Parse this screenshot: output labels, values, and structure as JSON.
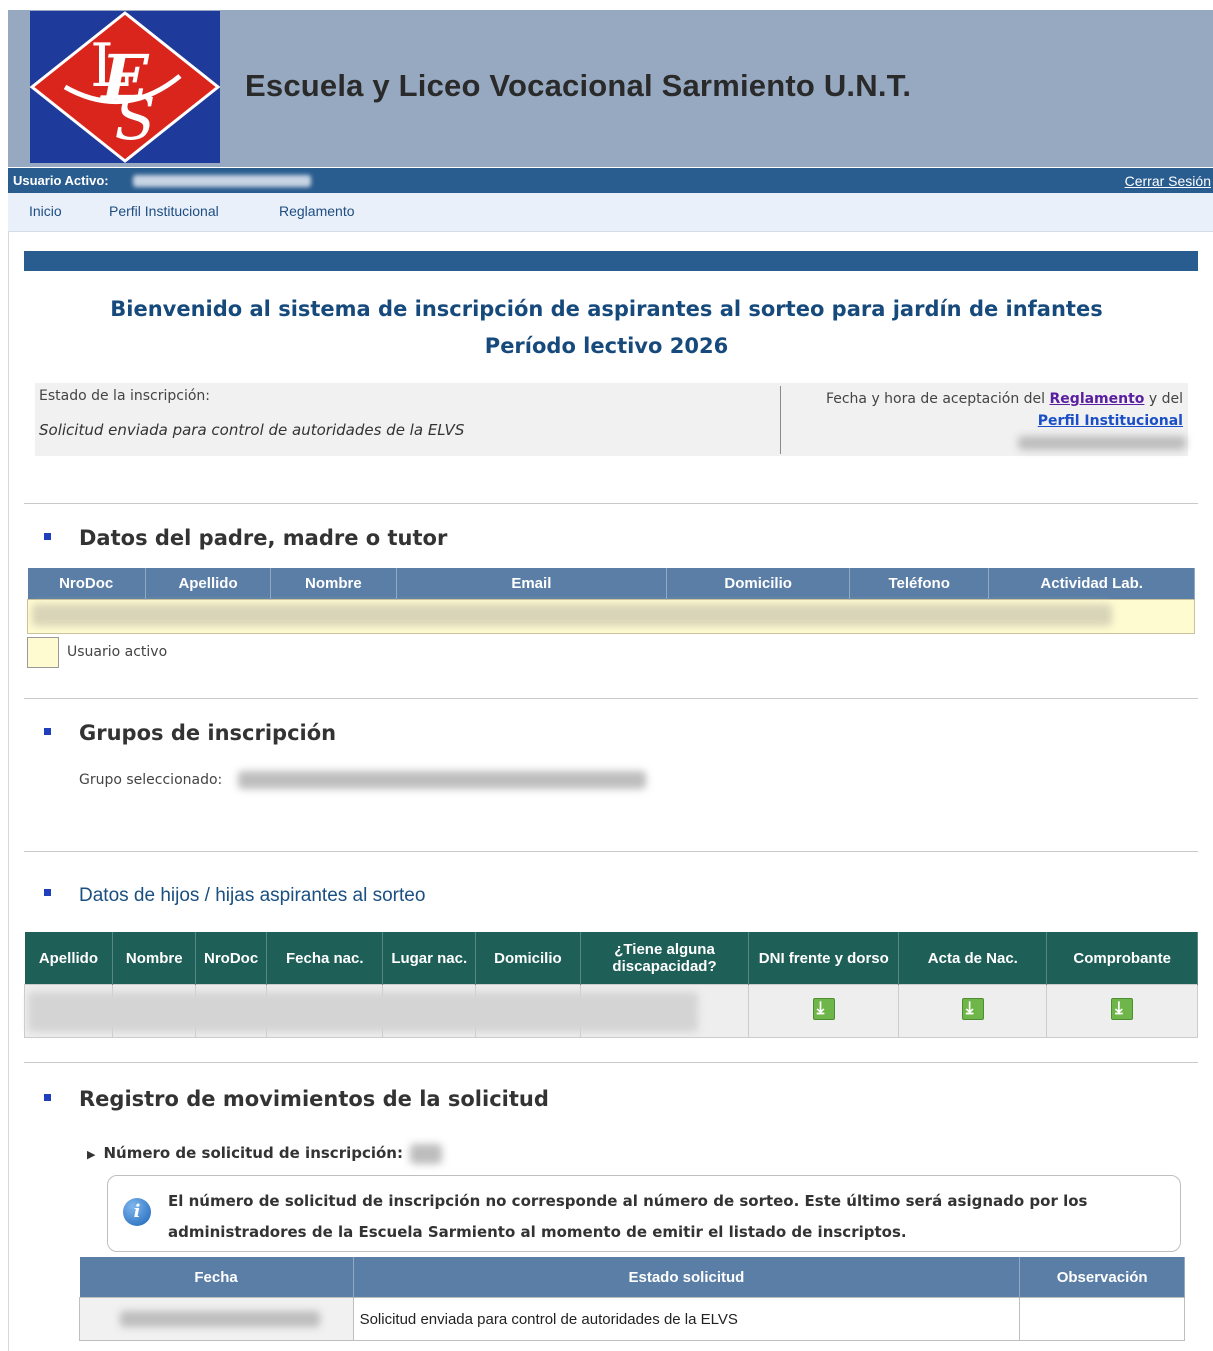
{
  "header": {
    "title": "Escuela y Liceo Vocacional Sarmiento U.N.T."
  },
  "userbar": {
    "label": "Usuario Activo:",
    "logout": "Cerrar Sesión"
  },
  "nav": {
    "items": [
      "Inicio",
      "Perfil Institucional",
      "Reglamento"
    ]
  },
  "welcome": {
    "line1": "Bienvenido al sistema de inscripción de aspirantes al sorteo para jardín de infantes",
    "line2": "Período lectivo 2026"
  },
  "status": {
    "label": "Estado de la inscripción:",
    "value": "Solicitud enviada para control de autoridades de la ELVS",
    "acceptance_prefix": "Fecha y hora de aceptación del",
    "reglamento_link": "Reglamento",
    "connector": "y del",
    "perfil_link": "Perfil Institucional"
  },
  "parents": {
    "title": "Datos del padre, madre o tutor",
    "columns": [
      "NroDoc",
      "Apellido",
      "Nombre",
      "Email",
      "Domicilio",
      "Teléfono",
      "Actividad Lab."
    ],
    "legend": "Usuario activo"
  },
  "groups": {
    "title": "Grupos de inscripción",
    "selected_label": "Grupo seleccionado:"
  },
  "children": {
    "title": "Datos de hijos / hijas aspirantes al sorteo",
    "columns": [
      "Apellido",
      "Nombre",
      "NroDoc",
      "Fecha nac.",
      "Lugar nac.",
      "Domicilio",
      "¿Tiene alguna discapacidad?",
      "DNI frente y dorso",
      "Acta de Nac.",
      "Comprobante"
    ]
  },
  "log": {
    "title": "Registro de movimientos de la solicitud",
    "request_number_label": "Número de solicitud de inscripción:",
    "info": "El número de solicitud de inscripción no corresponde al número de sorteo. Este último será asignado por los administradores de la Escuela Sarmiento al momento de emitir el listado de inscriptos.",
    "columns": [
      "Fecha",
      "Estado solicitud",
      "Observación"
    ],
    "rows": [
      {
        "estado": "Solicitud enviada para control de autoridades de la ELVS",
        "observacion": ""
      }
    ]
  },
  "colors": {
    "header_bg": "#96a9c0",
    "primary": "#2a5d8f",
    "title": "#174a7c",
    "table_head": "#5a7ea6",
    "children_head": "#1e5f58",
    "active_user": "#fffbd1"
  },
  "icons": {
    "logo": "elvs-logo",
    "download": "download-icon",
    "info": "info-icon",
    "bullet": "square-bullet",
    "expand": "triangle-right-icon"
  }
}
